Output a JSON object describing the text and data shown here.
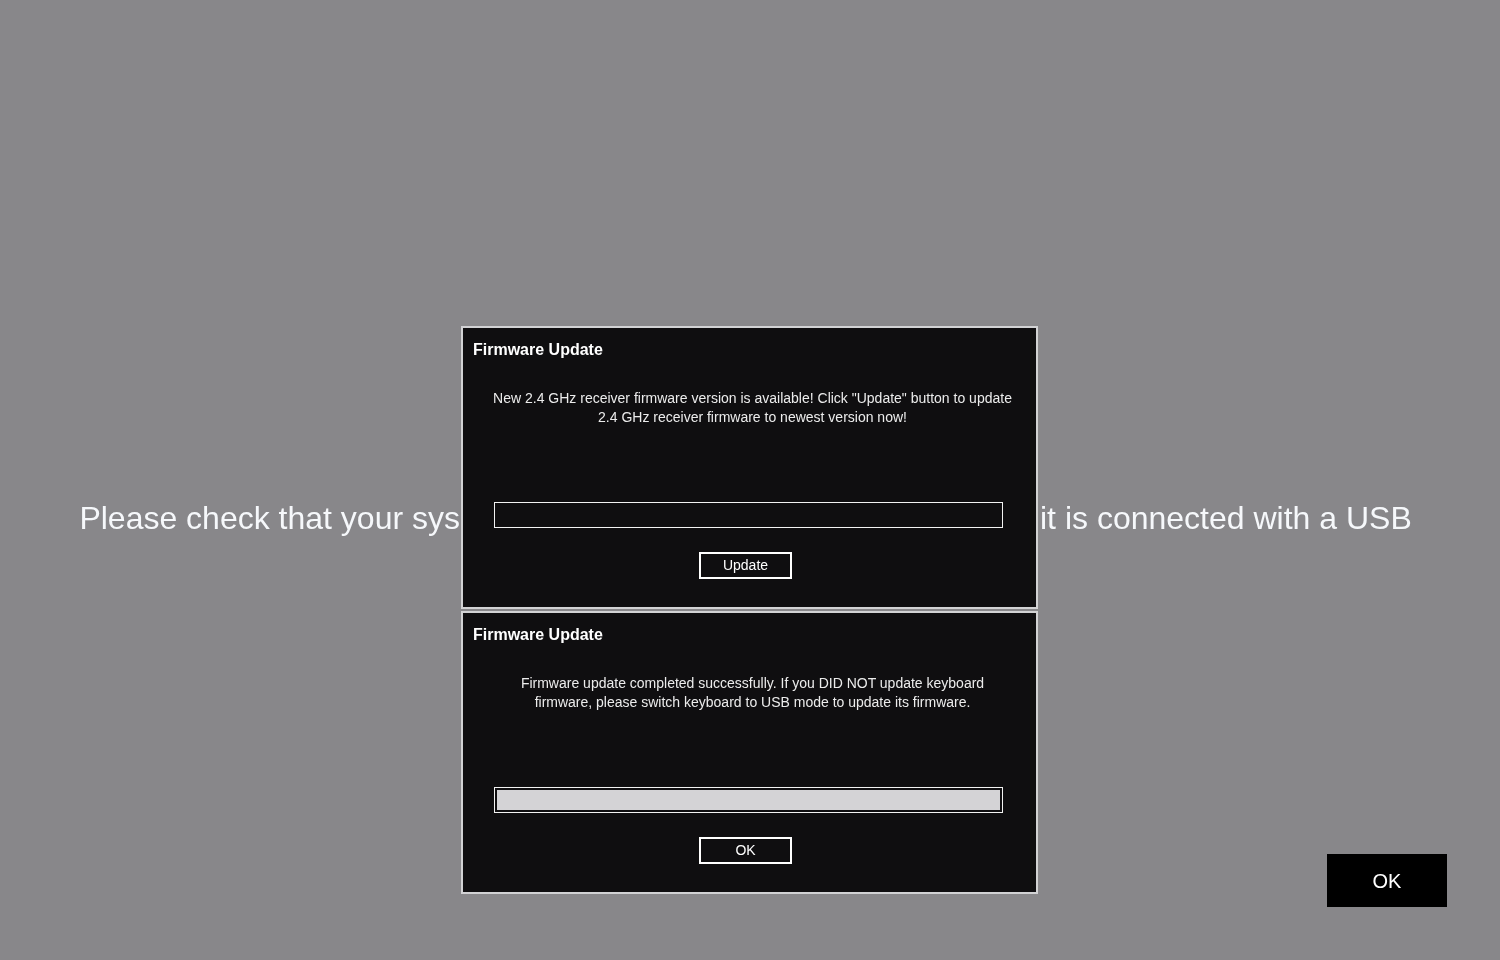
{
  "background_text": [
    "Please check that your sys",
    "it is connected with a USB"
  ],
  "dialogs": [
    {
      "title": "Firmware Update",
      "message": "New 2.4 GHz receiver firmware version is available! Click \"Update\" button to update\n2.4 GHz receiver firmware to newest version now!",
      "progress": {
        "level": 0
      },
      "button": "Update"
    },
    {
      "title": "Firmware Update",
      "message": "Firmware update completed successfully. If you DID NOT update keyboard\nfirmware, please switch keyboard to USB mode to update its firmware.",
      "progress": {
        "level": 1
      },
      "button": "OK"
    }
  ],
  "ok_button": "OK"
}
